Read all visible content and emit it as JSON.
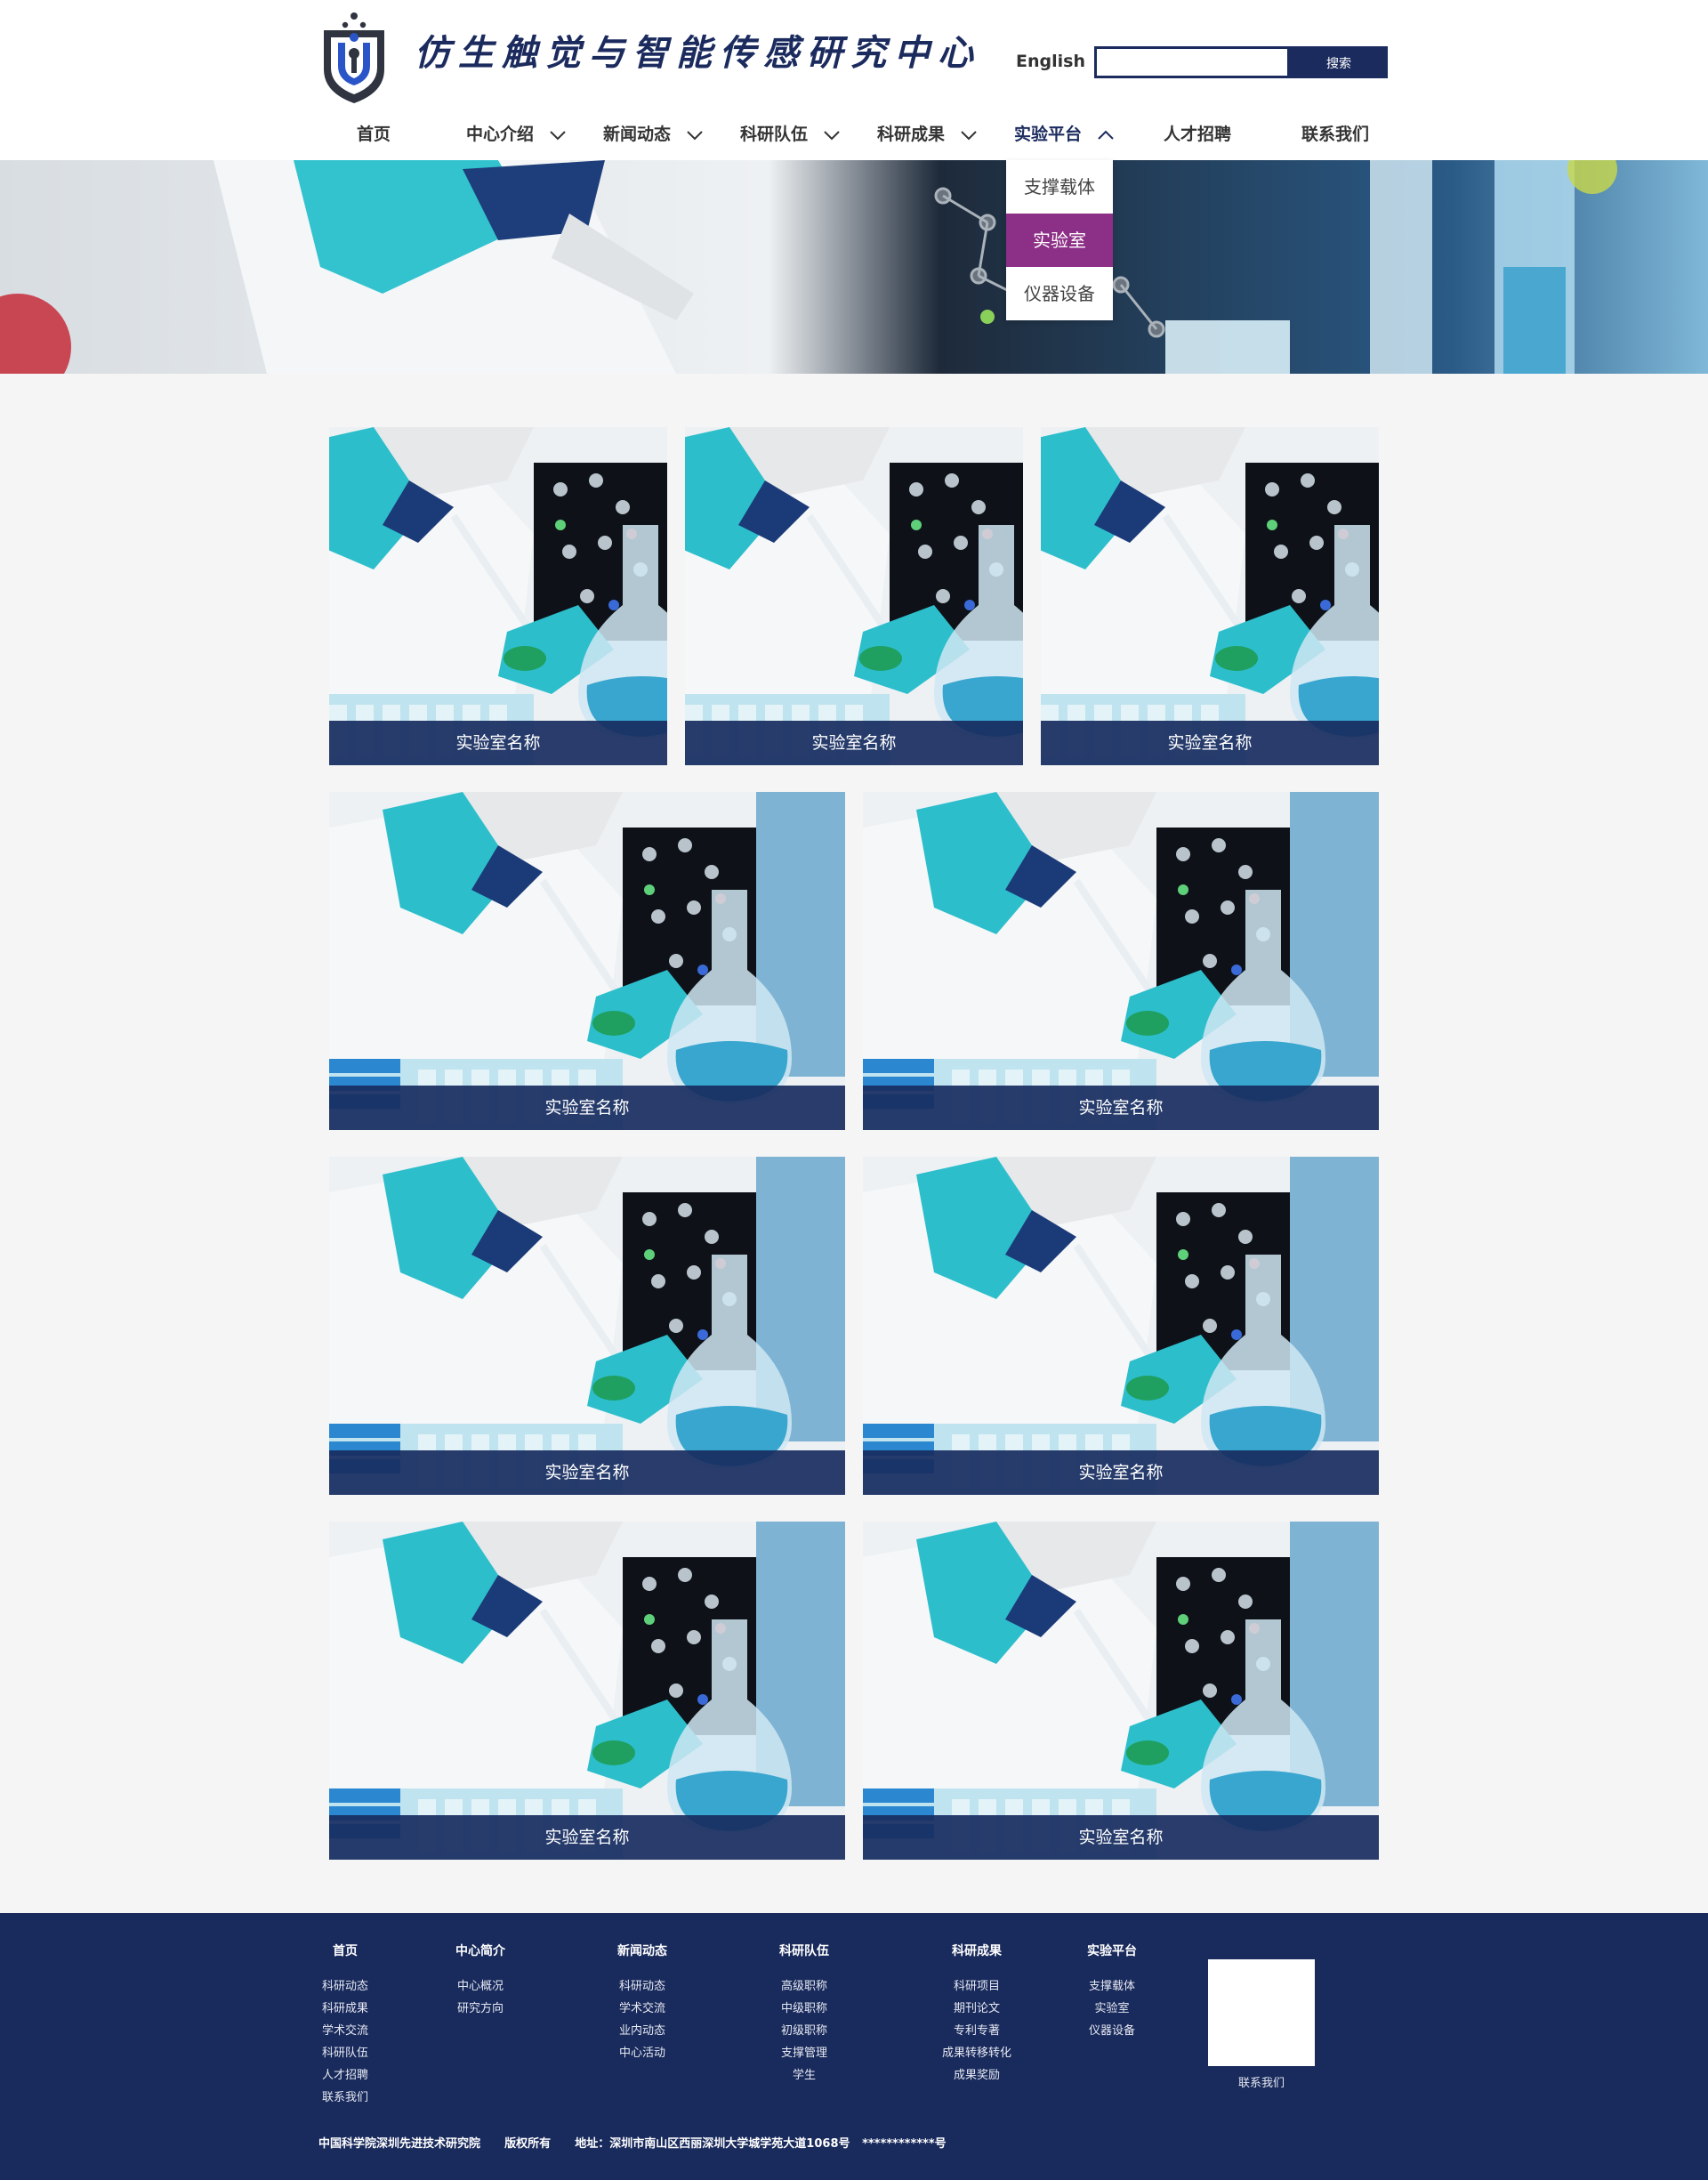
{
  "header": {
    "site_title": "仿生触觉与智能传感研究中心",
    "lang_link": "English",
    "search_placeholder": "",
    "search_button": "搜索"
  },
  "nav": {
    "items": [
      {
        "label": "首页",
        "has_dropdown": false
      },
      {
        "label": "中心介绍",
        "has_dropdown": true
      },
      {
        "label": "新闻动态",
        "has_dropdown": true
      },
      {
        "label": "科研队伍",
        "has_dropdown": true
      },
      {
        "label": "科研成果",
        "has_dropdown": true
      },
      {
        "label": "实验平台",
        "has_dropdown": true,
        "active": true
      },
      {
        "label": "人才招聘",
        "has_dropdown": false
      },
      {
        "label": "联系我们",
        "has_dropdown": false
      }
    ],
    "dropdown": [
      {
        "label": "支撑载体",
        "active": false
      },
      {
        "label": "实验室",
        "active": true
      },
      {
        "label": "仪器设备",
        "active": false
      }
    ]
  },
  "cards": {
    "row1": [
      "实验室名称",
      "实验室名称",
      "实验室名称"
    ],
    "row2": [
      "实验室名称",
      "实验室名称"
    ],
    "row3": [
      "实验室名称",
      "实验室名称"
    ],
    "row4": [
      "实验室名称",
      "实验室名称"
    ]
  },
  "footer": {
    "columns": [
      {
        "heading": "首页",
        "items": [
          "科研动态",
          "科研成果",
          "学术交流",
          "科研队伍",
          "人才招聘",
          "联系我们"
        ]
      },
      {
        "heading": "中心简介",
        "items": [
          "中心概况",
          "研究方向"
        ]
      },
      {
        "heading": "新闻动态",
        "items": [
          "科研动态",
          "学术交流",
          "业内动态",
          "中心活动"
        ]
      },
      {
        "heading": "科研队伍",
        "items": [
          "高级职称",
          "中级职称",
          "初级职称",
          "支撑管理",
          "学生"
        ]
      },
      {
        "heading": "科研成果",
        "items": [
          "科研项目",
          "期刊论文",
          "专利专著",
          "成果转移转化",
          "成果奖励"
        ]
      },
      {
        "heading": "实验平台",
        "items": [
          "支撑载体",
          "实验室",
          "仪器设备"
        ]
      }
    ],
    "qr_label": "联系我们",
    "copyright": "中国科学院深圳先进技术研究院      版权所有      地址：深圳市南山区西丽深圳大学城学苑大道1068号   ************号"
  },
  "colors": {
    "brand": "#1b2b5e",
    "accent": "#8c2f86",
    "footer_bg": "#192a5c"
  }
}
